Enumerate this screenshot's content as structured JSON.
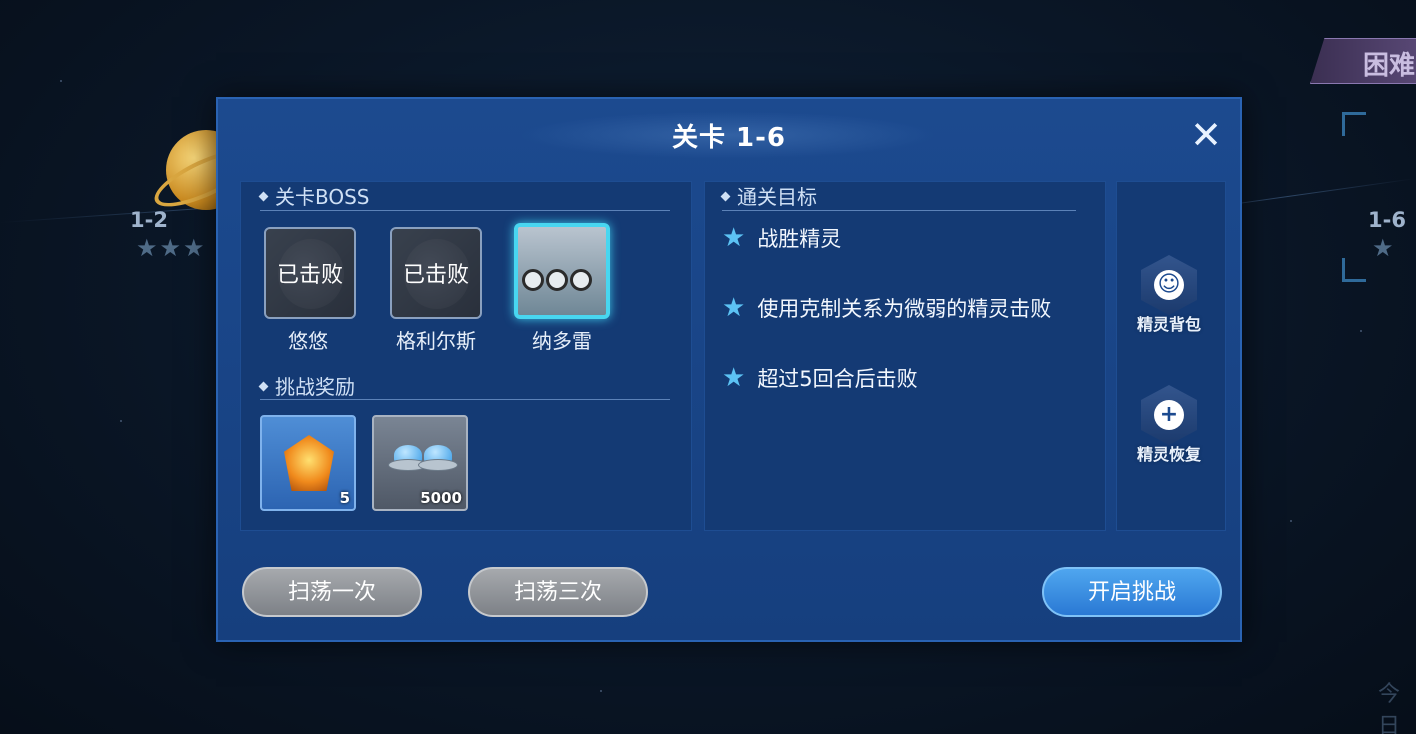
{
  "background": {
    "left_level": "1-2",
    "right_level": "1-6",
    "difficulty_tab": "困难",
    "bottom_right_text": "今日"
  },
  "dialog": {
    "title": "关卡 1-6",
    "close_icon": "close-icon",
    "boss_section": {
      "title": "关卡BOSS",
      "bosses": [
        {
          "name": "悠悠",
          "status": "已击败",
          "defeated": true
        },
        {
          "name": "格利尔斯",
          "status": "已击败",
          "defeated": true
        },
        {
          "name": "纳多雷",
          "status": "",
          "defeated": false
        }
      ]
    },
    "reward_section": {
      "title": "挑战奖励",
      "rewards": [
        {
          "icon": "medal-icon",
          "count": "5"
        },
        {
          "icon": "ufo-icon",
          "count": "5000"
        }
      ]
    },
    "goal_section": {
      "title": "通关目标",
      "goals": [
        "战胜精灵",
        "使用克制关系为微弱的精灵击败",
        "超过5回合后击败"
      ]
    },
    "side_buttons": [
      {
        "label": "精灵背包",
        "icon": "spirit-bag-icon"
      },
      {
        "label": "精灵恢复",
        "icon": "spirit-heal-icon"
      }
    ],
    "buttons": {
      "sweep_once": "扫荡一次",
      "sweep_three": "扫荡三次",
      "start": "开启挑战"
    }
  },
  "colors": {
    "dialog_bg": "#1c4a8f",
    "active_border": "#48d6f0",
    "star": "#5cc3f5",
    "start_button": "#2a79d4",
    "sweep_button": "#8e9297"
  }
}
